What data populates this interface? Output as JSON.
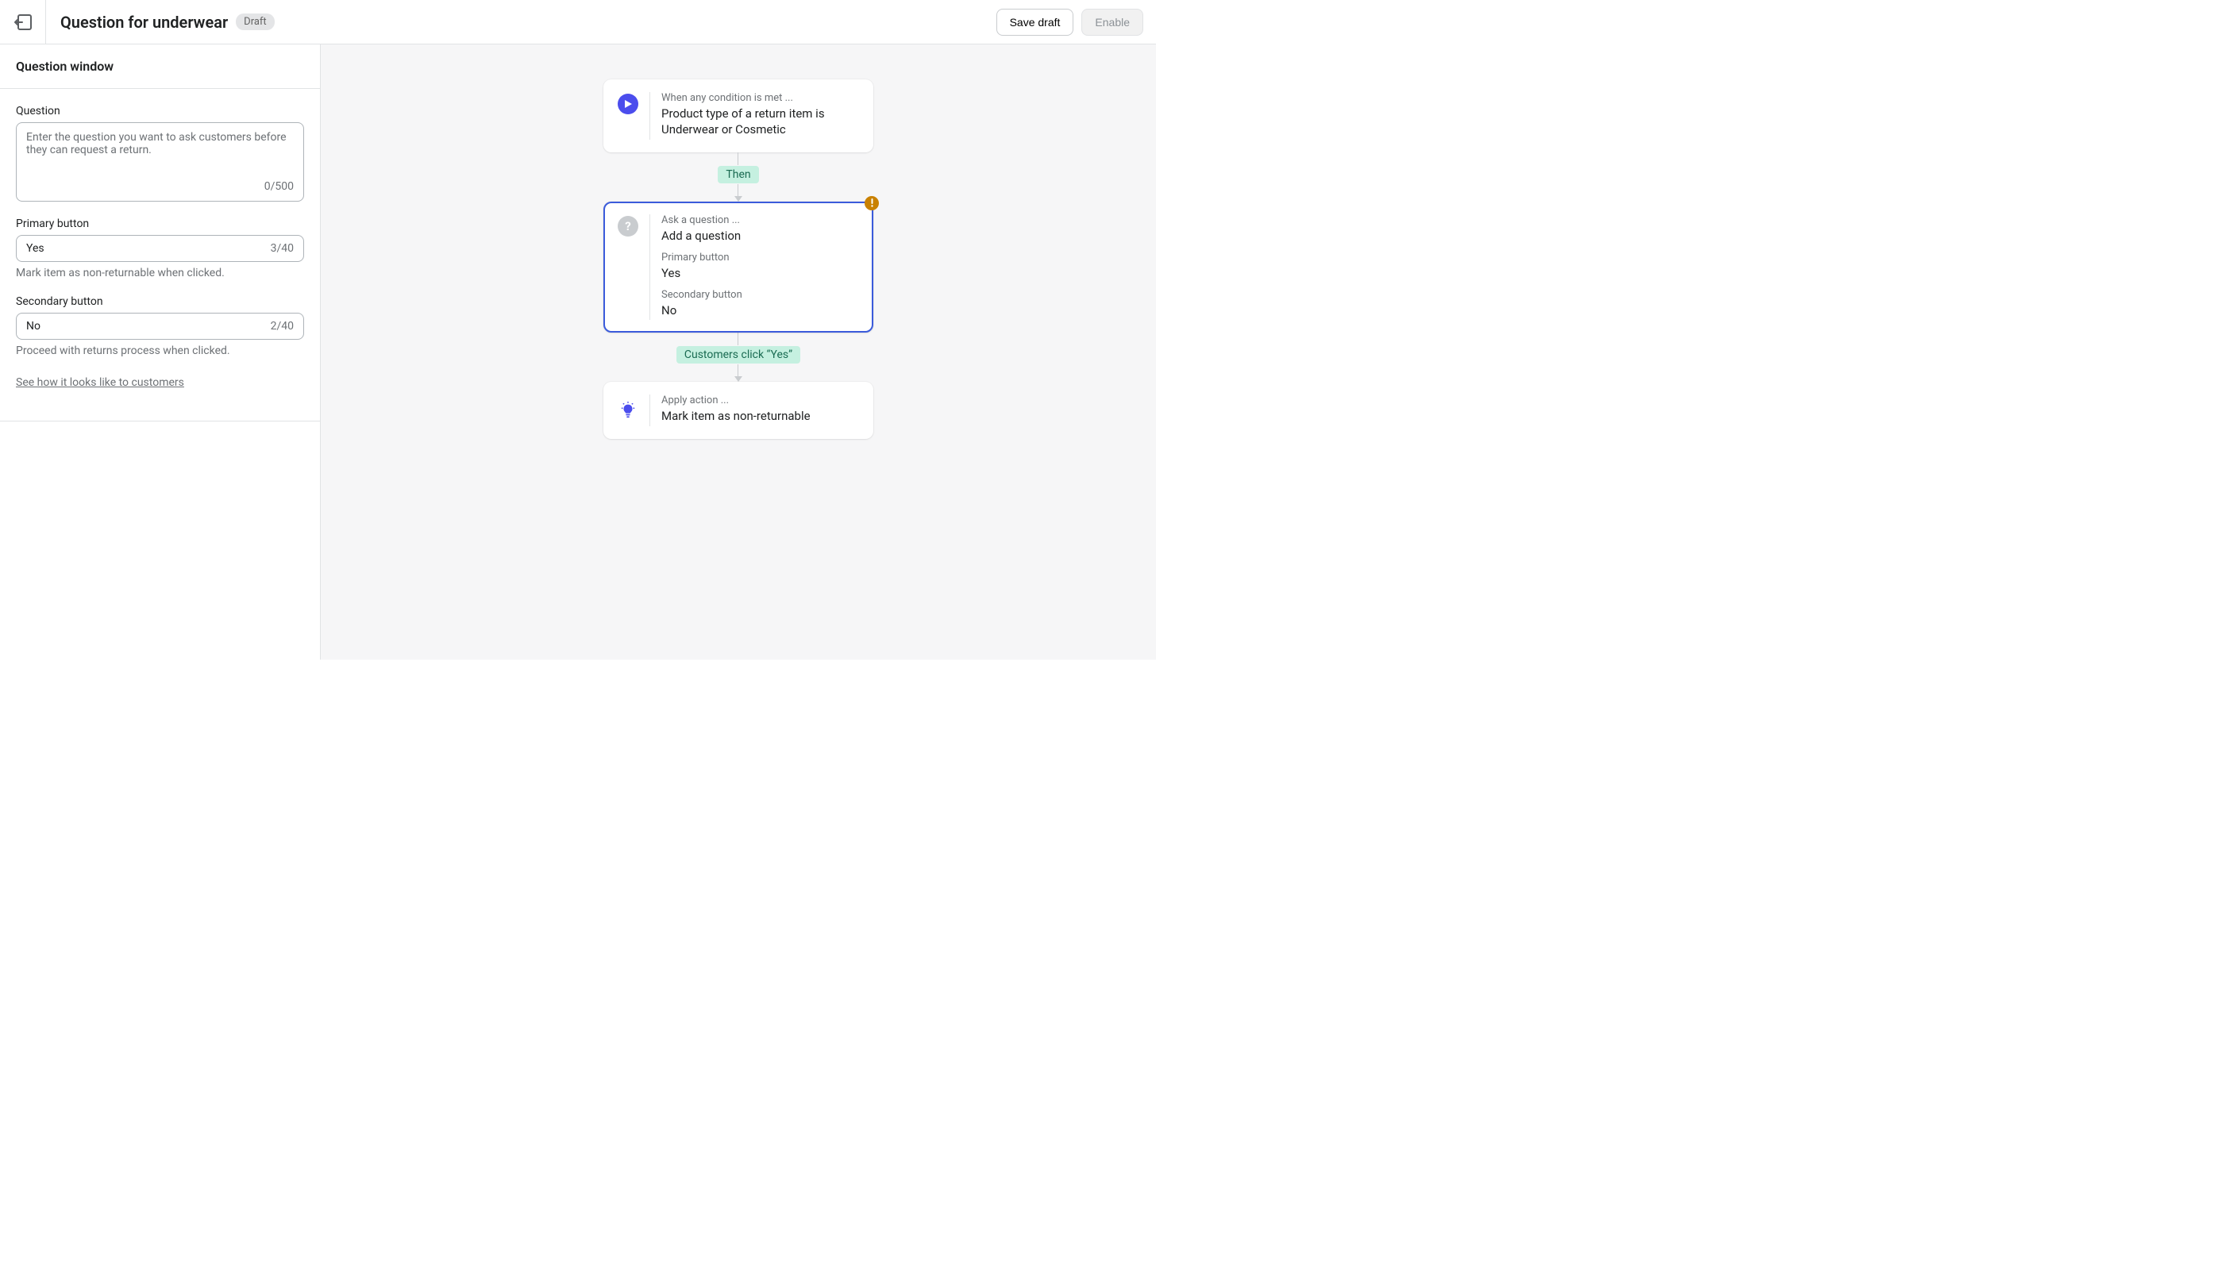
{
  "header": {
    "title": "Question for underwear",
    "badge": "Draft",
    "save_draft": "Save draft",
    "enable": "Enable"
  },
  "sidebar": {
    "title": "Question window",
    "question_label": "Question",
    "question_placeholder": "Enter the question you want to ask customers before they can request a return.",
    "question_counter": "0/500",
    "primary_label": "Primary button",
    "primary_value": "Yes",
    "primary_counter": "3/40",
    "primary_helper": "Mark item as non-returnable when clicked.",
    "secondary_label": "Secondary button",
    "secondary_value": "No",
    "secondary_counter": "2/40",
    "secondary_helper": "Proceed with returns process when clicked.",
    "preview_link": "See how it looks like to customers"
  },
  "flow": {
    "card1_sub": "When any condition is met ...",
    "card1_title": "Product type of a return item is Underwear or Cosmetic",
    "conn1": "Then",
    "card2_sub": "Ask a question ...",
    "card2_title": "Add a question",
    "card2_primary_label": "Primary button",
    "card2_primary_value": "Yes",
    "card2_secondary_label": "Secondary button",
    "card2_secondary_value": "No",
    "conn2": "Customers click “Yes”",
    "card3_sub": "Apply action ...",
    "card3_title": "Mark item as non-returnable"
  }
}
